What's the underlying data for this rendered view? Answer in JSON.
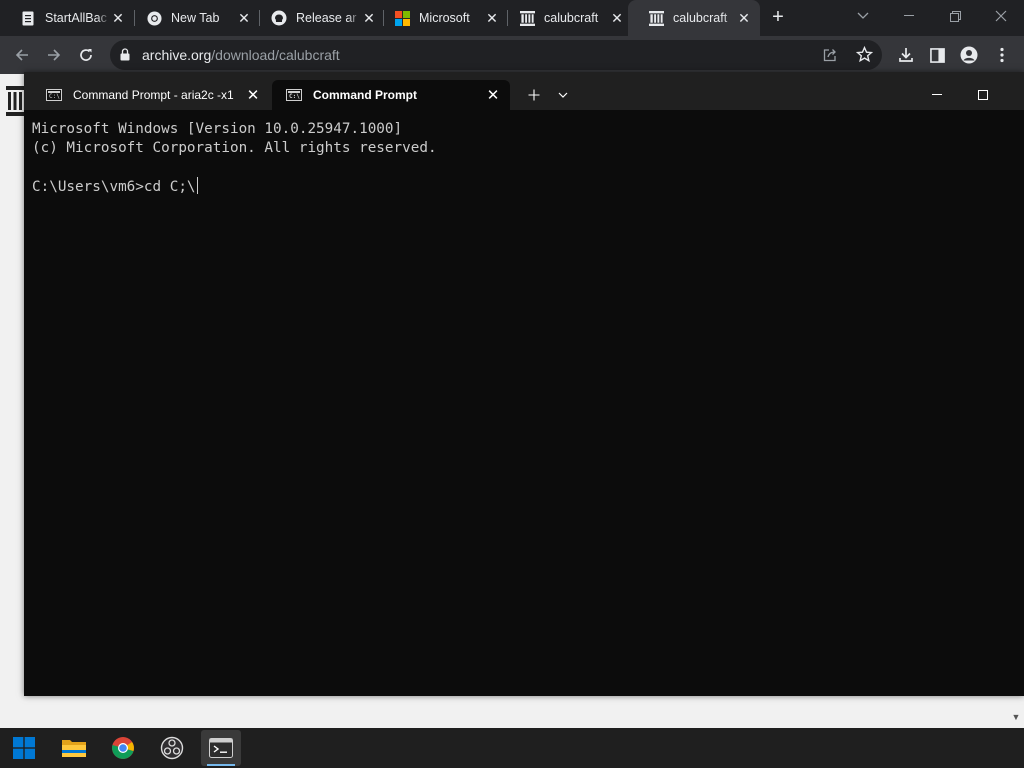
{
  "browser": {
    "tabs": [
      {
        "title": "StartAllBac",
        "icon": "document-icon"
      },
      {
        "title": "New Tab",
        "icon": "chrome-icon"
      },
      {
        "title": "Release ar",
        "icon": "github-icon"
      },
      {
        "title": "Microsoft",
        "icon": "microsoft-logo-icon"
      },
      {
        "title": "calubcraft",
        "icon": "archive-org-icon"
      },
      {
        "title": "calubcraft",
        "icon": "archive-org-icon",
        "active": true
      }
    ],
    "url_host": "archive.org",
    "url_path": "/download/calubcraft"
  },
  "terminal": {
    "tabs": [
      {
        "label": "Command Prompt - aria2c  -x1"
      },
      {
        "label": "Command Prompt",
        "active": true
      }
    ],
    "lines": [
      "Microsoft Windows [Version 10.0.25947.1000]",
      "(c) Microsoft Corporation. All rights reserved.",
      "",
      "C:\\Users\\vm6>cd C;\\"
    ]
  },
  "taskbar": {
    "items": [
      "start-button",
      "file-explorer",
      "google-chrome",
      "obs-studio",
      "terminal"
    ],
    "active": "terminal"
  },
  "colors": {
    "chrome_dark": "#202124",
    "chrome_toolbar": "#35363a",
    "terminal_bg": "#0c0c0c",
    "terminal_text": "#cccccc",
    "windows_blue": "#0078d4"
  }
}
